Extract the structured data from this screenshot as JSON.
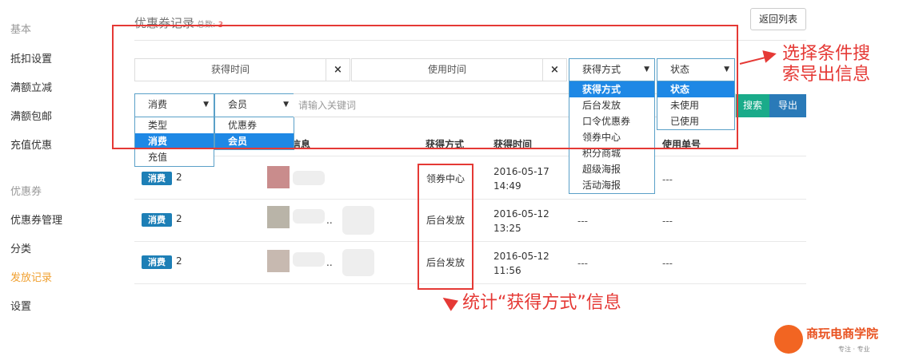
{
  "sidebar": {
    "items": [
      {
        "label": "基本",
        "type": "head"
      },
      {
        "label": "抵扣设置"
      },
      {
        "label": "满额立减"
      },
      {
        "label": "满额包邮"
      },
      {
        "label": "充值优惠"
      },
      {
        "label": "优惠券",
        "type": "head"
      },
      {
        "label": "优惠券管理"
      },
      {
        "label": "分类"
      },
      {
        "label": "发放记录",
        "active": true
      },
      {
        "label": "设置"
      }
    ]
  },
  "header": {
    "title": "优惠券记录",
    "count_label": "总数:",
    "count": "3",
    "back_label": "返回列表"
  },
  "filters": {
    "get_time": "获得时间",
    "use_time": "使用时间",
    "clear": "×",
    "get_method": {
      "selected": "获得方式",
      "options": [
        "获得方式",
        "后台发放",
        "口令优惠券",
        "领券中心",
        "积分商城",
        "超级海报",
        "活动海报"
      ]
    },
    "status": {
      "selected": "状态",
      "options": [
        "状态",
        "未使用",
        "已使用"
      ]
    },
    "type": {
      "selected": "消费",
      "options": [
        "类型",
        "消费",
        "充值"
      ]
    },
    "member": {
      "selected": "会员",
      "options": [
        "优惠券",
        "会员"
      ]
    },
    "keyword_placeholder": "请输入关键词",
    "search_label": "搜索",
    "export_label": "导出"
  },
  "table": {
    "headers": [
      "信息",
      "获得方式",
      "获得时间",
      "使用单号"
    ],
    "rows": [
      {
        "badge": "消费",
        "num": "2",
        "method": "领券中心",
        "date": "2016-05-17",
        "time": "14:49",
        "use_time": "",
        "order": "---"
      },
      {
        "badge": "消费",
        "num": "2",
        "method": "后台发放",
        "date": "2016-05-12",
        "time": "13:25",
        "use_time": "---",
        "order": "---"
      },
      {
        "badge": "消费",
        "num": "2",
        "method": "后台发放",
        "date": "2016-05-12",
        "time": "11:56",
        "use_time": "---",
        "order": "---"
      }
    ],
    "ellipsis": ".."
  },
  "annotations": {
    "search_note_line1": "选择条件搜",
    "search_note_line2": "索导出信息",
    "stat_note": "统计“获得方式”信息"
  },
  "logo": {
    "name": "商玩电商学院",
    "tagline": "专注 · 专业"
  },
  "colors": {
    "accent_orange": "#f0a030",
    "annotation_red": "#e53935",
    "badge_blue": "#1d7fb6",
    "search_green": "#1aab8a",
    "export_blue": "#2a7ab8",
    "dropdown_highlight": "#1e88e5"
  }
}
